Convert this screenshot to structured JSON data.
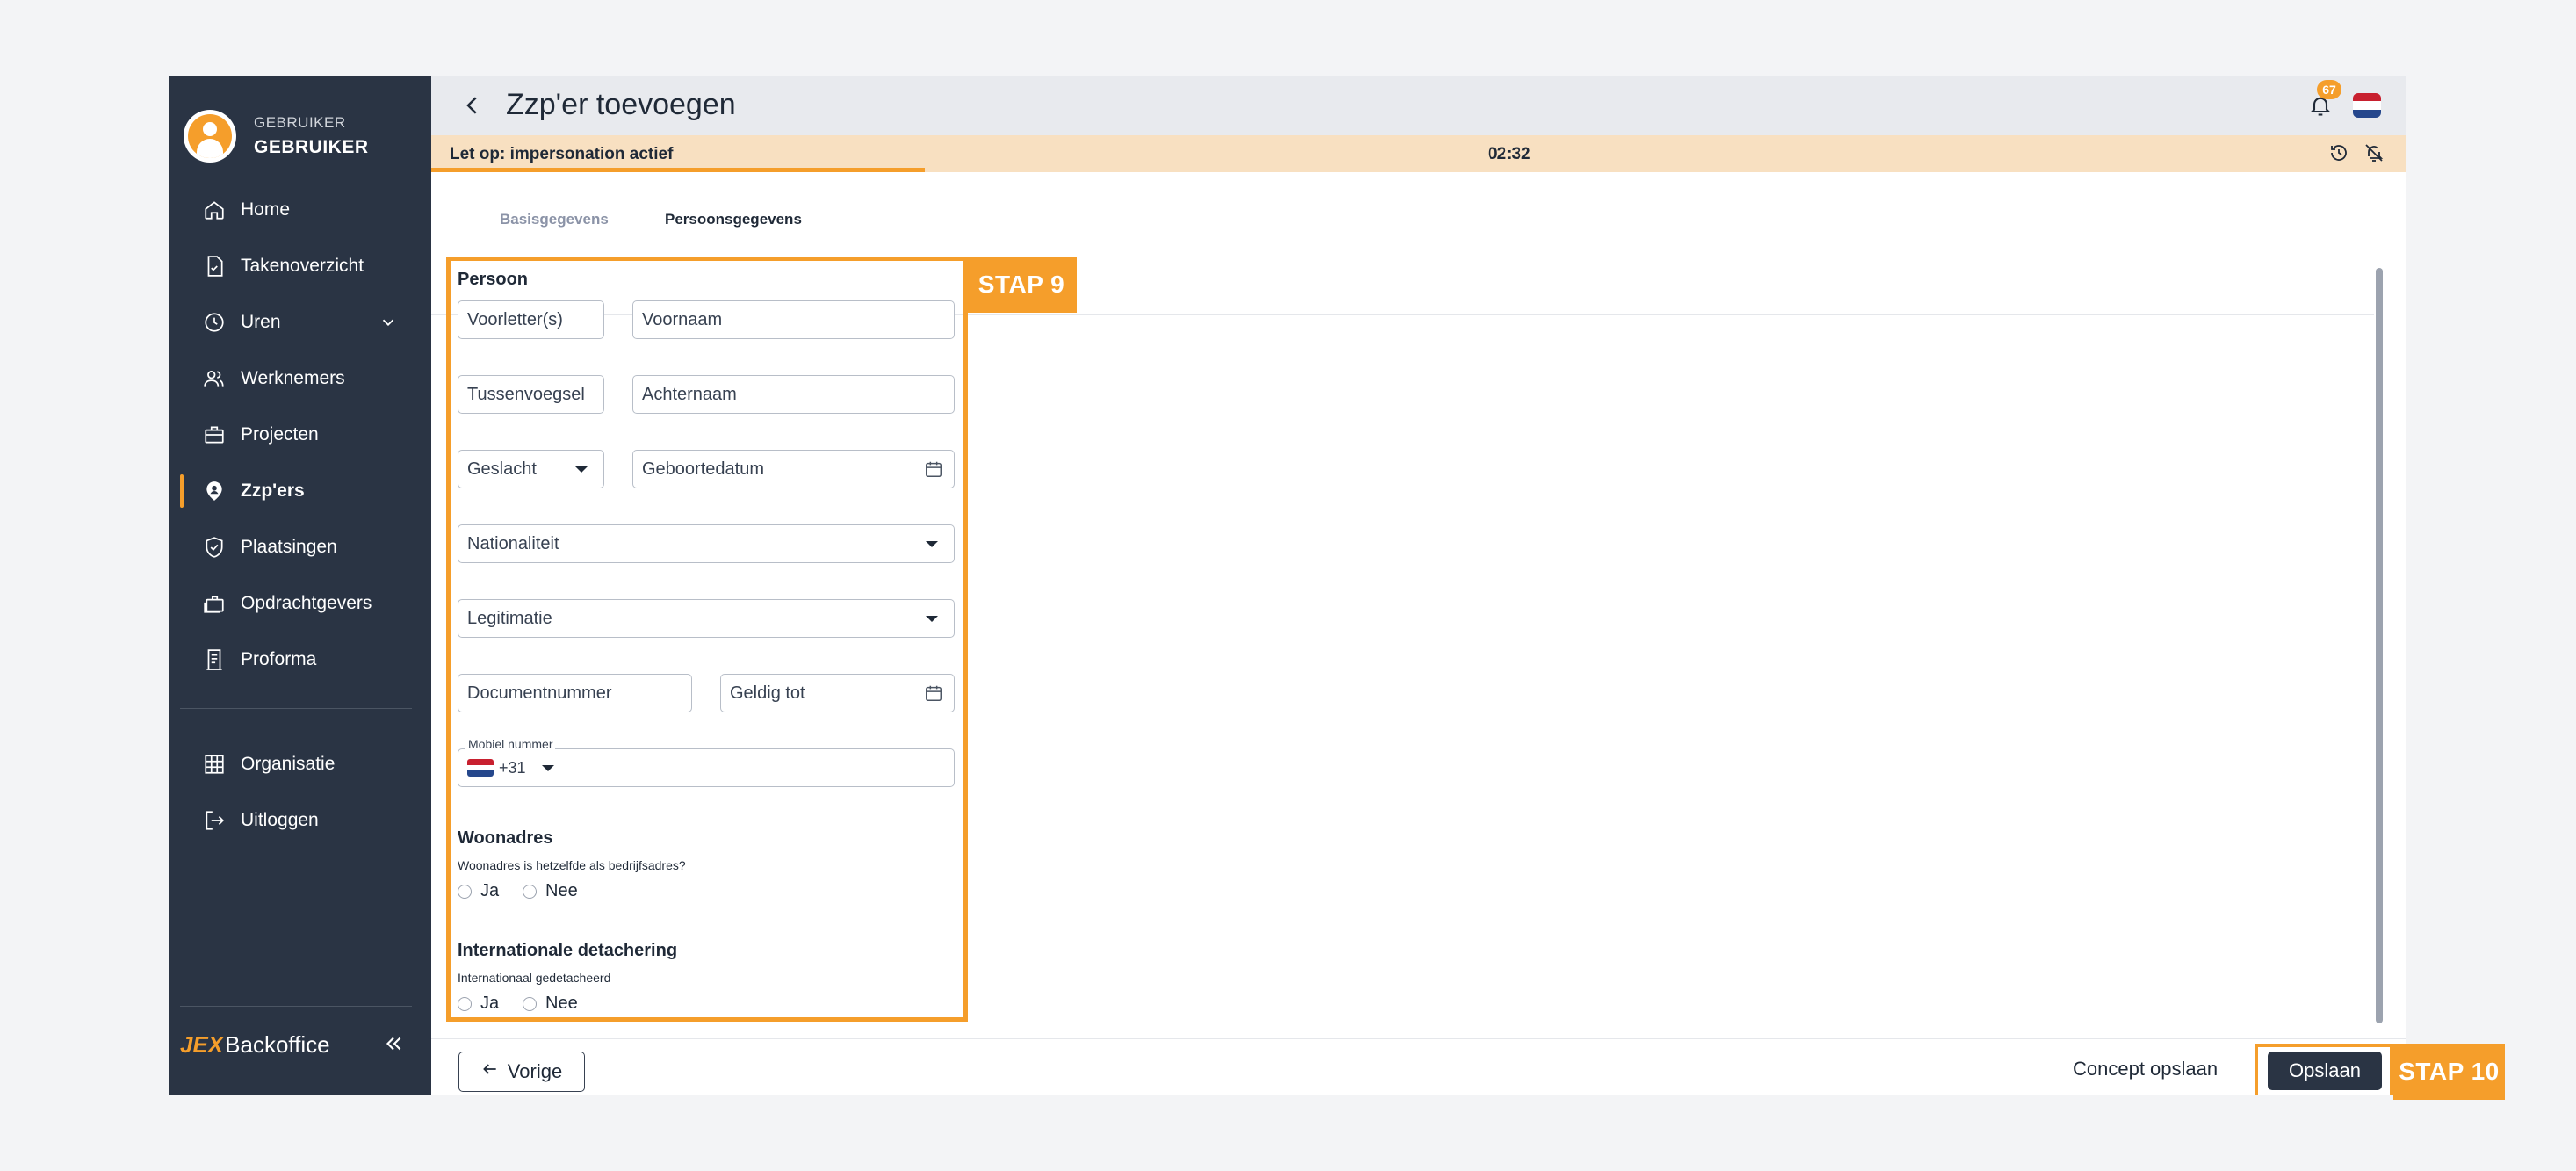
{
  "user": {
    "role": "GEBRUIKER",
    "name": "GEBRUIKER"
  },
  "nav": [
    {
      "label": "Home",
      "icon": "home-icon"
    },
    {
      "label": "Takenoverzicht",
      "icon": "task-icon"
    },
    {
      "label": "Uren",
      "icon": "clock-icon"
    },
    {
      "label": "Werknemers",
      "icon": "users-icon"
    },
    {
      "label": "Projecten",
      "icon": "briefcase-icon"
    },
    {
      "label": "Zzp'ers",
      "icon": "person-pin-icon"
    },
    {
      "label": "Plaatsingen",
      "icon": "shield-check-icon"
    },
    {
      "label": "Opdrachtgevers",
      "icon": "portfolio-icon"
    },
    {
      "label": "Proforma",
      "icon": "receipt-icon"
    },
    {
      "label": "Organisatie",
      "icon": "building-icon"
    },
    {
      "label": "Uitloggen",
      "icon": "logout-icon"
    }
  ],
  "brand": {
    "prefix": "JEX",
    "name": "Backoffice"
  },
  "header": {
    "title": "Zzp'er toevoegen",
    "notification_count": "67"
  },
  "banner": {
    "text": "Let op: impersonation actief",
    "timer": "02:32",
    "progress": 0.25
  },
  "tabs": {
    "basis": "Basisgegevens",
    "persoons": "Persoonsgegevens"
  },
  "form": {
    "persoon_title": "Persoon",
    "voorletters": "Voorletter(s)",
    "voornaam": "Voornaam",
    "tussenvoegsel": "Tussenvoegsel",
    "achternaam": "Achternaam",
    "geslacht": "Geslacht",
    "geboortedatum": "Geboortedatum",
    "nationaliteit": "Nationaliteit",
    "legitimatie": "Legitimatie",
    "documentnummer": "Documentnummer",
    "geldig_tot": "Geldig tot",
    "mobiel_label": "Mobiel nummer",
    "country_code": "+31",
    "woonadres_title": "Woonadres",
    "woonadres_question": "Woonadres is hetzelfde als bedrijfsadres?",
    "ja": "Ja",
    "nee": "Nee",
    "detachering_title": "Internationale detachering",
    "detachering_question": "Internationaal gedetacheerd"
  },
  "annotations": {
    "stap9": "STAP 9",
    "stap10": "STAP 10"
  },
  "footer": {
    "vorige": "Vorige",
    "concept": "Concept opslaan",
    "opslaan": "Opslaan"
  },
  "colors": {
    "accent": "#f59e2b",
    "sidebar": "#2a3444",
    "banner": "#f8e0c1"
  }
}
